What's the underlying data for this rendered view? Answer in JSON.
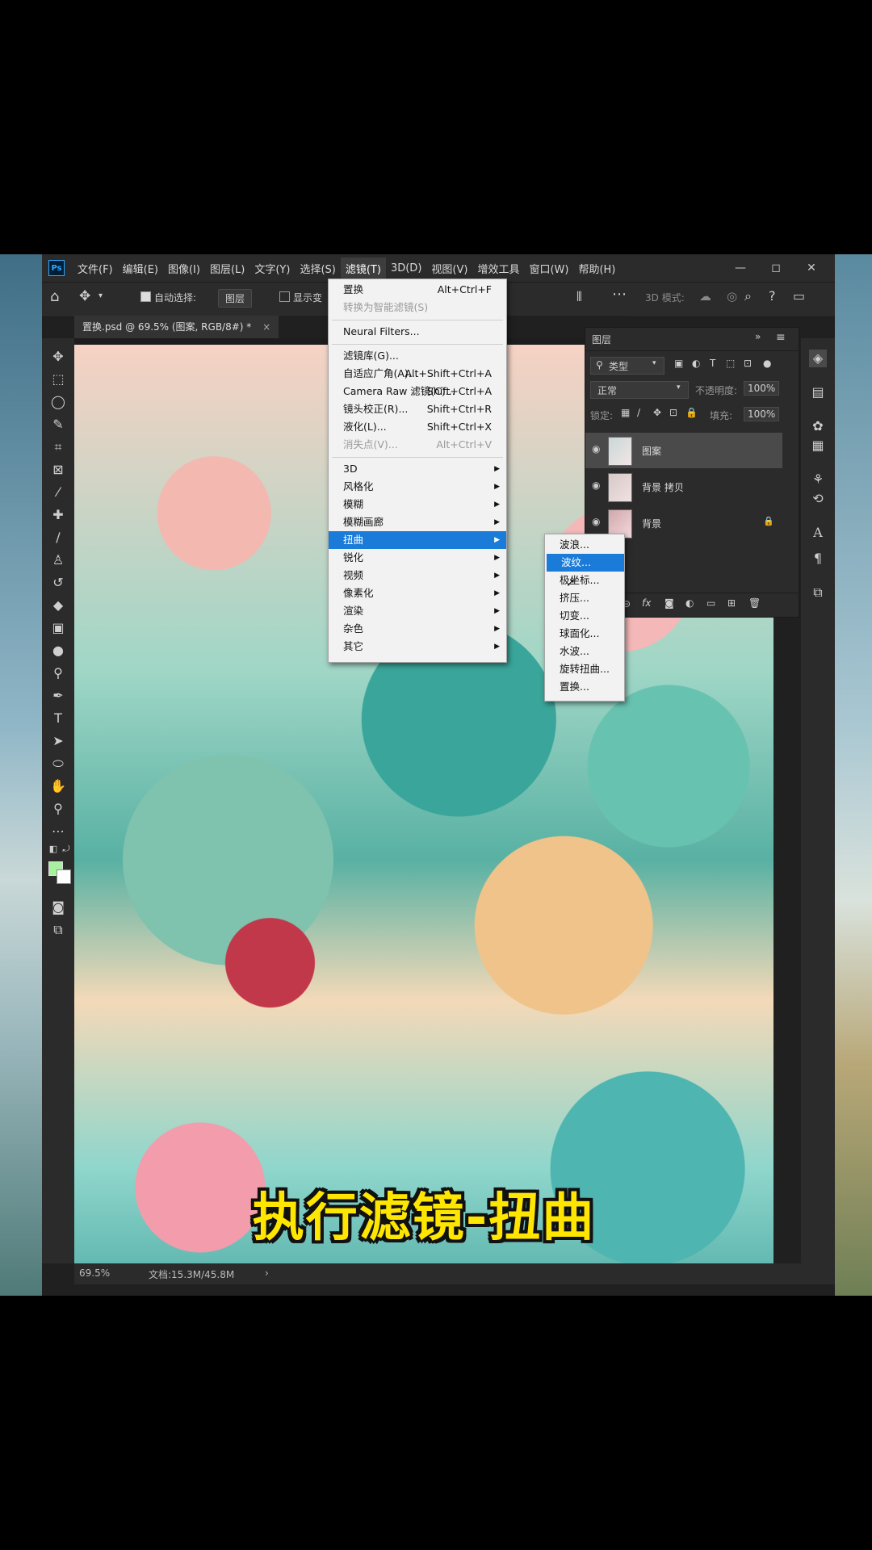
{
  "menubar": {
    "logo": "Ps",
    "items": [
      "文件(F)",
      "编辑(E)",
      "图像(I)",
      "图层(L)",
      "文字(Y)",
      "选择(S)",
      "滤镜(T)",
      "3D(D)",
      "视图(V)",
      "增效工具",
      "窗口(W)",
      "帮助(H)"
    ],
    "window_controls": [
      "—",
      "◻",
      "✕"
    ]
  },
  "options": {
    "auto_select_label": "自动选择:",
    "auto_select_target": "图层",
    "show_transform": "显示变",
    "mode3d": "3D 模式:"
  },
  "document": {
    "tab_title": "置换.psd @ 69.5% (图案, RGB/8#) *",
    "tab_close": "×",
    "caption": "执行滤镜-扭曲"
  },
  "status": {
    "zoom": "69.5%",
    "doc_size": "文档:15.3M/45.8M",
    "arrow": "›"
  },
  "layers_panel": {
    "title": "图层",
    "filter_kind": "类型",
    "blend_mode": "正常",
    "opacity_label": "不透明度:",
    "opacity_value": "100%",
    "lock_label": "锁定:",
    "fill_label": "填充:",
    "fill_value": "100%",
    "layers": [
      {
        "name": "图案",
        "locked": false
      },
      {
        "name": "背景 拷贝",
        "locked": false
      },
      {
        "name": "背景",
        "locked": true
      }
    ]
  },
  "filter_menu": {
    "items": [
      {
        "label": "置换",
        "shortcut": "Alt+Ctrl+F",
        "disabled": false
      },
      {
        "label": "转换为智能滤镜(S)",
        "shortcut": "",
        "disabled": true
      },
      {
        "label": "Neural Filters...",
        "shortcut": "",
        "disabled": false
      },
      {
        "label": "滤镜库(G)...",
        "shortcut": "",
        "disabled": false
      },
      {
        "label": "自适应广角(A)...",
        "shortcut": "Alt+Shift+Ctrl+A",
        "disabled": false
      },
      {
        "label": "Camera Raw 滤镜(C)...",
        "shortcut": "Shift+Ctrl+A",
        "disabled": false
      },
      {
        "label": "镜头校正(R)...",
        "shortcut": "Shift+Ctrl+R",
        "disabled": false
      },
      {
        "label": "液化(L)...",
        "shortcut": "Shift+Ctrl+X",
        "disabled": false
      },
      {
        "label": "消失点(V)...",
        "shortcut": "Alt+Ctrl+V",
        "disabled": true
      },
      {
        "label": "3D",
        "submenu": true
      },
      {
        "label": "风格化",
        "submenu": true
      },
      {
        "label": "模糊",
        "submenu": true
      },
      {
        "label": "模糊画廊",
        "submenu": true
      },
      {
        "label": "扭曲",
        "submenu": true,
        "highlighted": true
      },
      {
        "label": "锐化",
        "submenu": true
      },
      {
        "label": "视频",
        "submenu": true
      },
      {
        "label": "像素化",
        "submenu": true
      },
      {
        "label": "渲染",
        "submenu": true
      },
      {
        "label": "杂色",
        "submenu": true
      },
      {
        "label": "其它",
        "submenu": true
      }
    ]
  },
  "distort_submenu": {
    "items": [
      "波浪...",
      "波纹...",
      "极坐标...",
      "挤压...",
      "切变...",
      "球面化...",
      "水波...",
      "旋转扭曲...",
      "置换..."
    ],
    "highlighted_index": 1
  },
  "colors": {
    "highlight": "#1a7bd8",
    "foreground_swatch": "#a8f0a0",
    "background_swatch": "#ffffff",
    "caption_text": "#ffe600"
  }
}
